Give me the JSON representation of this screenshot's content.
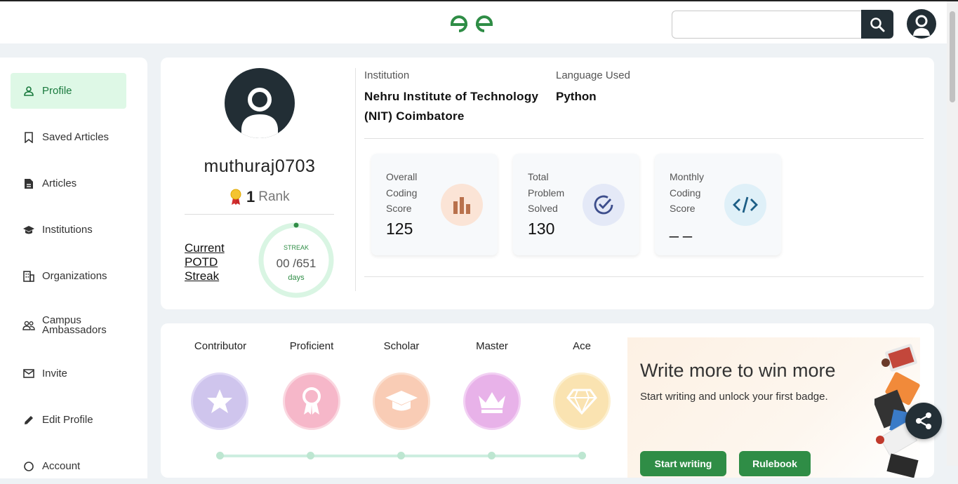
{
  "header": {
    "search": {
      "placeholder": "",
      "value": ""
    }
  },
  "sidebar": {
    "items": [
      {
        "label": "Profile",
        "icon": "user-icon",
        "active": true
      },
      {
        "label": "Saved Articles",
        "icon": "bookmark-icon"
      },
      {
        "label": "Articles",
        "icon": "document-icon"
      },
      {
        "label": "Institutions",
        "icon": "graduation-cap-icon"
      },
      {
        "label": "Organizations",
        "icon": "building-icon"
      },
      {
        "label": "Campus Ambassadors",
        "icon": "group-icon"
      },
      {
        "label": "Invite",
        "icon": "mail-icon"
      },
      {
        "label": "Edit Profile",
        "icon": "pencil-icon"
      },
      {
        "label": "Account",
        "icon": "account-icon"
      }
    ]
  },
  "profile": {
    "username": "muthuraj0703",
    "rank_value": "1",
    "rank_label": "Rank",
    "potd_label": "Current POTD Streak",
    "streak": {
      "label": "STREAK",
      "value": "00 /651",
      "unit": "days"
    },
    "institution_label": "Institution",
    "institution_value": "Nehru Institute of Technology (NIT) Coimbatore",
    "language_label": "Language Used",
    "language_value": "Python",
    "stats": [
      {
        "label": "Overall Coding Score",
        "value": "125",
        "icon": "bar-chart-icon",
        "color": "#fbe4d6"
      },
      {
        "label": "Total Problem Solved",
        "value": "130",
        "icon": "check-circle-icon",
        "color": "#e4e9f7"
      },
      {
        "label": "Monthly Coding Score",
        "value": "_ _",
        "icon": "code-icon",
        "color": "#dff0f8"
      }
    ]
  },
  "badges": {
    "levels": [
      {
        "name": "Contributor",
        "icon": "star-icon",
        "color": "#b7a6e6"
      },
      {
        "name": "Proficient",
        "icon": "ribbon-icon",
        "color": "#f29bb2"
      },
      {
        "name": "Scholar",
        "icon": "graduation-cap-icon",
        "color": "#f7b590"
      },
      {
        "name": "Master",
        "icon": "crown-icon",
        "color": "#d78ad8"
      },
      {
        "name": "Ace",
        "icon": "diamond-icon",
        "color": "#f8d58a"
      }
    ],
    "promo": {
      "title": "Write more to win more",
      "subtitle": "Start writing and unlock your first badge.",
      "start_label": "Start writing",
      "rulebook_label": "Rulebook"
    }
  },
  "colors": {
    "brand_green": "#2f8d46",
    "dark": "#232f36",
    "active_bg": "#def8e6"
  }
}
